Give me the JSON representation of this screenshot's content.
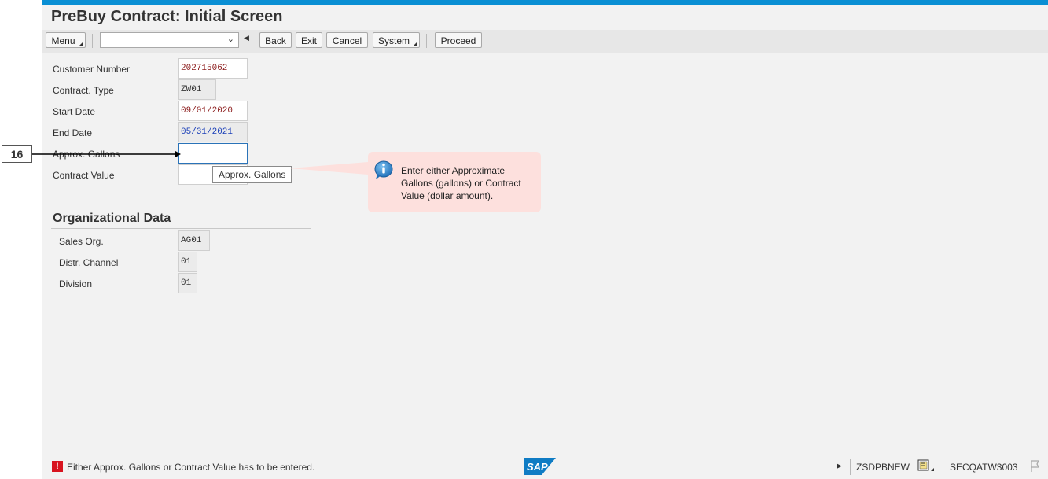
{
  "window": {
    "title": "PreBuy Contract: Initial Screen"
  },
  "toolbar": {
    "menu_label": "Menu",
    "command_field_value": "",
    "back_label": "Back",
    "exit_label": "Exit",
    "cancel_label": "Cancel",
    "system_label": "System",
    "proceed_label": "Proceed"
  },
  "form": {
    "customer_number": {
      "label": "Customer Number",
      "value": "202715062"
    },
    "contract_type": {
      "label": "Contract. Type",
      "value": "ZW01"
    },
    "start_date": {
      "label": "Start Date",
      "value": "09/01/2020"
    },
    "end_date": {
      "label": "End Date",
      "value": "05/31/2021"
    },
    "approx_gallons": {
      "label": "Approx. Gallons",
      "value": ""
    },
    "contract_value": {
      "label": "Contract Value",
      "value": ""
    }
  },
  "tooltip": {
    "text": "Approx. Gallons"
  },
  "org_data": {
    "title": "Organizational Data",
    "sales_org": {
      "label": "Sales Org.",
      "value": "AG01"
    },
    "distr_channel": {
      "label": "Distr. Channel",
      "value": "01"
    },
    "division": {
      "label": "Division",
      "value": "01"
    }
  },
  "callout": {
    "step_number": "16",
    "text": "Enter either Approximate Gallons (gallons) or Contract Value (dollar amount)."
  },
  "status_bar": {
    "message": "Either Approx. Gallons or Contract Value has to be entered.",
    "transaction": "ZSDPBNEW",
    "system": "SECQATW3003",
    "error_color": "#d8141f"
  },
  "colors": {
    "accent": "#0a8fd4",
    "sap_blue": "#0f7cc4",
    "callout_bg": "#fde0dd"
  }
}
